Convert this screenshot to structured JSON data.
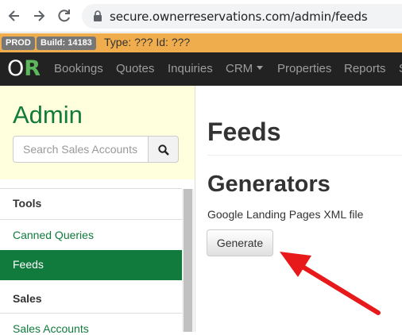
{
  "browser": {
    "url": "secure.ownerreservations.com/admin/feeds"
  },
  "env": {
    "prod": "PROD",
    "build": "Build: 14183",
    "info": "Type: ??? Id: ???"
  },
  "navbar": {
    "brand_o": "O",
    "brand_r": "R",
    "items": [
      "Bookings",
      "Quotes",
      "Inquiries",
      "CRM",
      "Properties",
      "Reports",
      "S"
    ]
  },
  "sidebar": {
    "title": "Admin",
    "search_placeholder": "Search Sales Accounts",
    "sections": [
      {
        "header": "Tools",
        "links": [
          "Canned Queries",
          "Feeds"
        ]
      },
      {
        "header": "Sales",
        "links": [
          "Sales Accounts"
        ]
      }
    ],
    "active": "Feeds"
  },
  "main": {
    "title": "Feeds",
    "section_title": "Generators",
    "feed_label": "Google Landing Pages XML file",
    "button_label": "Generate"
  },
  "colors": {
    "brand_green": "#117a3d",
    "env_bar": "#f0ad4e",
    "annotation_arrow": "#e8191b"
  }
}
